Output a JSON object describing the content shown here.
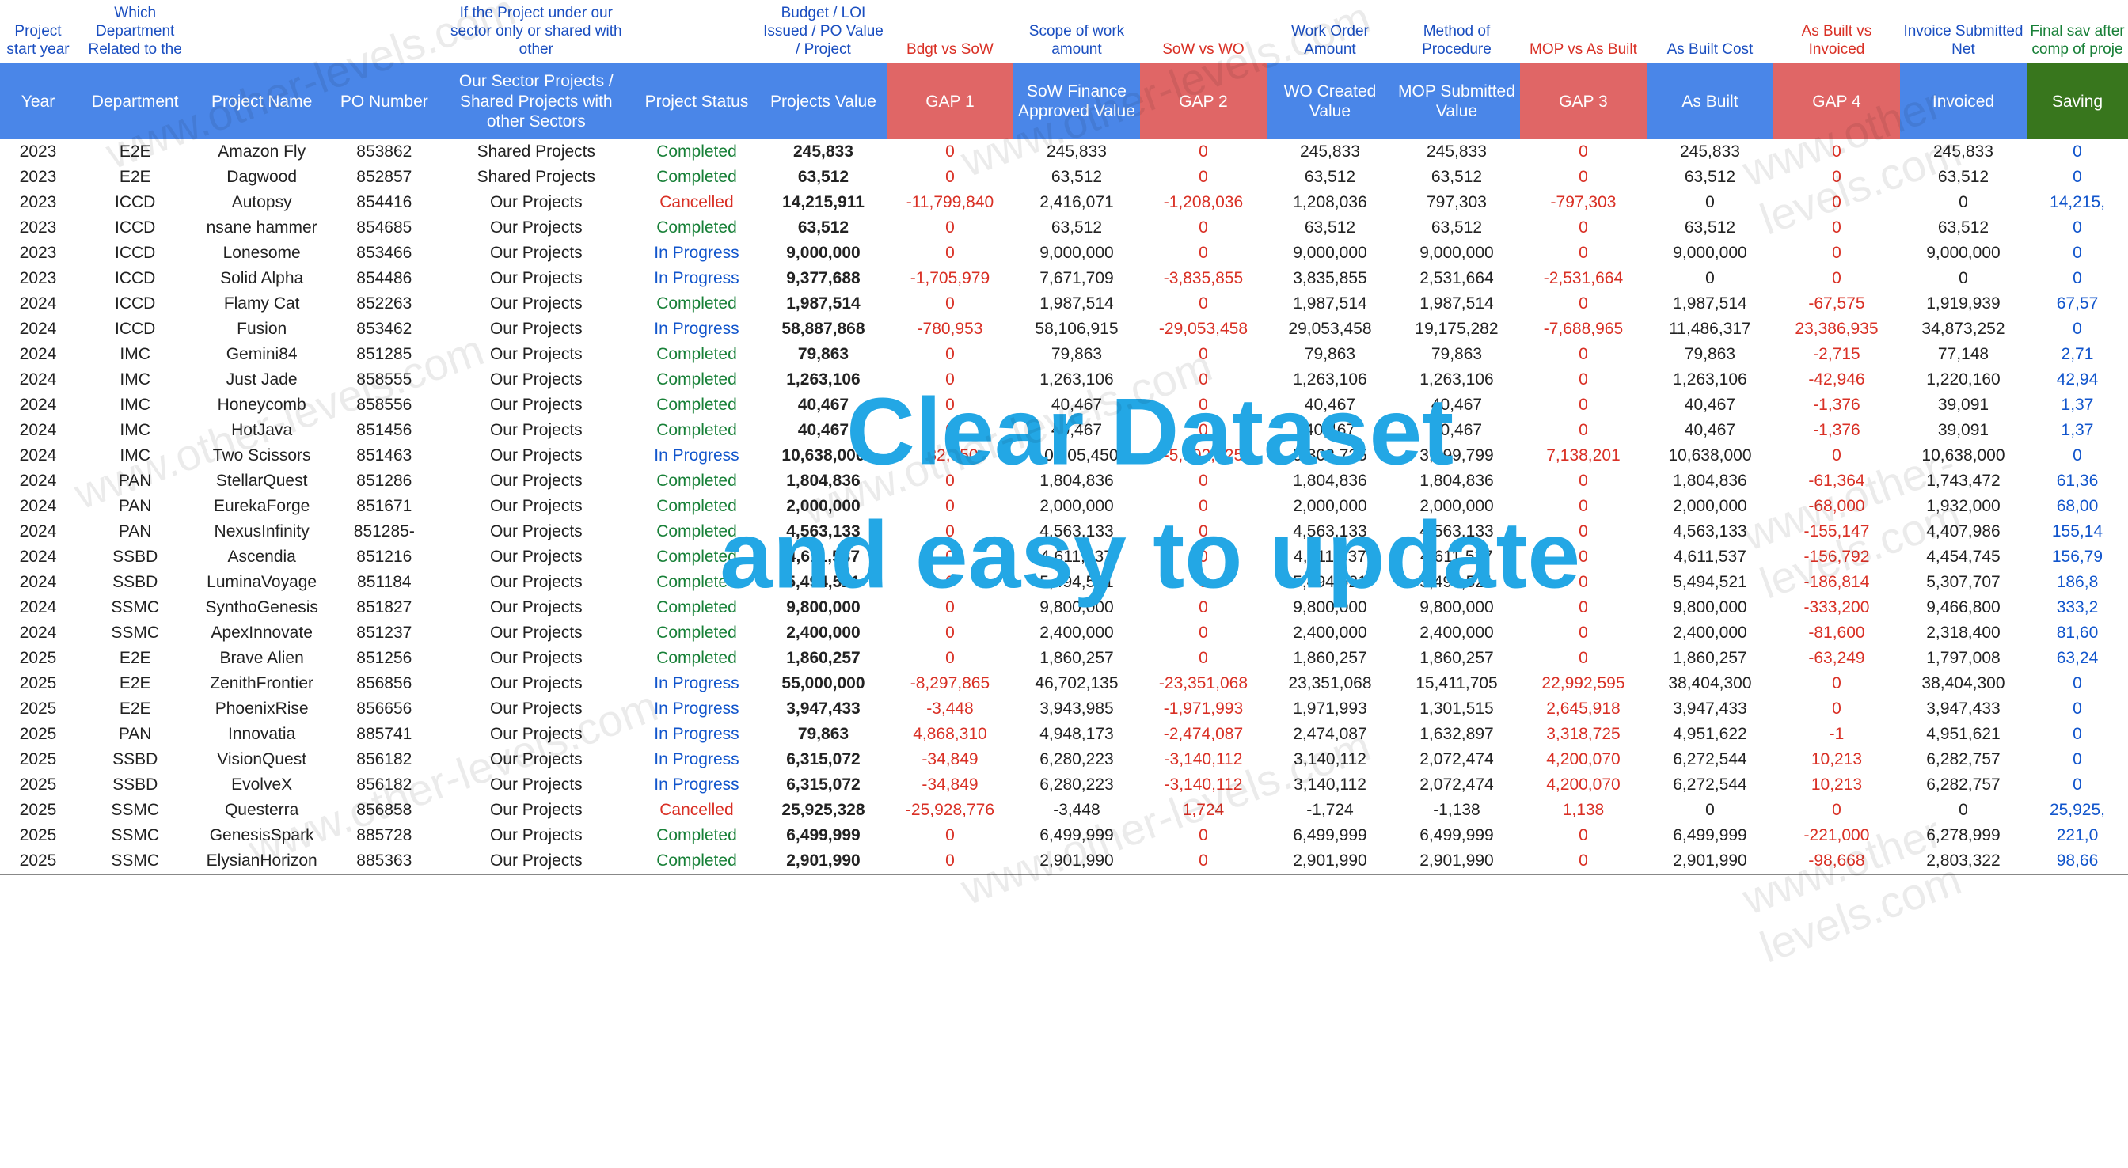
{
  "overlay": {
    "line1": "Clear Dataset",
    "line2": "and easy to update"
  },
  "watermark": "www.other-levels.com",
  "columns_desc": [
    {
      "text": "Project start year",
      "cls": ""
    },
    {
      "text": "Which Department Related to the",
      "cls": ""
    },
    {
      "text": "",
      "cls": ""
    },
    {
      "text": "",
      "cls": ""
    },
    {
      "text": "If the Project under our sector only or shared with other",
      "cls": ""
    },
    {
      "text": "",
      "cls": ""
    },
    {
      "text": "Budget / LOI Issued / PO Value / Project",
      "cls": ""
    },
    {
      "text": "Bdgt vs SoW",
      "cls": "red"
    },
    {
      "text": "Scope of work amount",
      "cls": ""
    },
    {
      "text": "SoW vs WO",
      "cls": "red"
    },
    {
      "text": "Work Order Amount",
      "cls": ""
    },
    {
      "text": "Method of Procedure",
      "cls": ""
    },
    {
      "text": "MOP vs As Built",
      "cls": "red"
    },
    {
      "text": "As Built Cost",
      "cls": ""
    },
    {
      "text": "As Built vs Invoiced",
      "cls": "red"
    },
    {
      "text": "Invoice Submitted Net",
      "cls": ""
    },
    {
      "text": "Final sav after comp of proje",
      "cls": "green"
    }
  ],
  "columns_main": [
    {
      "text": "Year",
      "cls": "blue"
    },
    {
      "text": "Department",
      "cls": "blue"
    },
    {
      "text": "Project Name",
      "cls": "blue"
    },
    {
      "text": "PO Number",
      "cls": "blue"
    },
    {
      "text": "Our Sector Projects / Shared Projects with other Sectors",
      "cls": "blue"
    },
    {
      "text": "Project Status",
      "cls": "blue"
    },
    {
      "text": "Projects Value",
      "cls": "blue"
    },
    {
      "text": "GAP 1",
      "cls": "redbg"
    },
    {
      "text": "SoW Finance Approved Value",
      "cls": "blue"
    },
    {
      "text": "GAP 2",
      "cls": "redbg"
    },
    {
      "text": "WO Created Value",
      "cls": "blue"
    },
    {
      "text": "MOP Submitted Value",
      "cls": "blue"
    },
    {
      "text": "GAP 3",
      "cls": "redbg"
    },
    {
      "text": "As Built",
      "cls": "blue"
    },
    {
      "text": "GAP 4",
      "cls": "redbg"
    },
    {
      "text": "Invoiced",
      "cls": "blue"
    },
    {
      "text": "Saving",
      "cls": "greenbg"
    }
  ],
  "rows": [
    {
      "year": "2023",
      "dept": "E2E",
      "proj": "Amazon Fly",
      "po": "853862",
      "sector": "Shared Projects",
      "status": "Completed",
      "pv": "245,833",
      "g1": "0",
      "sow": "245,833",
      "g2": "0",
      "wo": "245,833",
      "mop": "245,833",
      "g3": "0",
      "asb": "245,833",
      "g4": "0",
      "inv": "245,833",
      "sav": "0"
    },
    {
      "year": "2023",
      "dept": "E2E",
      "proj": "Dagwood",
      "po": "852857",
      "sector": "Shared Projects",
      "status": "Completed",
      "pv": "63,512",
      "g1": "0",
      "sow": "63,512",
      "g2": "0",
      "wo": "63,512",
      "mop": "63,512",
      "g3": "0",
      "asb": "63,512",
      "g4": "0",
      "inv": "63,512",
      "sav": "0"
    },
    {
      "year": "2023",
      "dept": "ICCD",
      "proj": "Autopsy",
      "po": "854416",
      "sector": "Our Projects",
      "status": "Cancelled",
      "pv": "14,215,911",
      "g1": "-11,799,840",
      "sow": "2,416,071",
      "g2": "-1,208,036",
      "wo": "1,208,036",
      "mop": "797,303",
      "g3": "-797,303",
      "asb": "0",
      "g4": "0",
      "inv": "0",
      "sav": "14,215,"
    },
    {
      "year": "2023",
      "dept": "ICCD",
      "proj": "nsane hammer",
      "po": "854685",
      "sector": "Our Projects",
      "status": "Completed",
      "pv": "63,512",
      "g1": "0",
      "sow": "63,512",
      "g2": "0",
      "wo": "63,512",
      "mop": "63,512",
      "g3": "0",
      "asb": "63,512",
      "g4": "0",
      "inv": "63,512",
      "sav": "0"
    },
    {
      "year": "2023",
      "dept": "ICCD",
      "proj": "Lonesome",
      "po": "853466",
      "sector": "Our Projects",
      "status": "In Progress",
      "pv": "9,000,000",
      "g1": "0",
      "sow": "9,000,000",
      "g2": "0",
      "wo": "9,000,000",
      "mop": "9,000,000",
      "g3": "0",
      "asb": "9,000,000",
      "g4": "0",
      "inv": "9,000,000",
      "sav": "0"
    },
    {
      "year": "2023",
      "dept": "ICCD",
      "proj": "Solid Alpha",
      "po": "854486",
      "sector": "Our Projects",
      "status": "In Progress",
      "pv": "9,377,688",
      "g1": "-1,705,979",
      "sow": "7,671,709",
      "g2": "-3,835,855",
      "wo": "3,835,855",
      "mop": "2,531,664",
      "g3": "-2,531,664",
      "asb": "0",
      "g4": "0",
      "inv": "0",
      "sav": "0"
    },
    {
      "year": "2024",
      "dept": "ICCD",
      "proj": "Flamy Cat",
      "po": "852263",
      "sector": "Our Projects",
      "status": "Completed",
      "pv": "1,987,514",
      "g1": "0",
      "sow": "1,987,514",
      "g2": "0",
      "wo": "1,987,514",
      "mop": "1,987,514",
      "g3": "0",
      "asb": "1,987,514",
      "g4": "-67,575",
      "inv": "1,919,939",
      "sav": "67,57"
    },
    {
      "year": "2024",
      "dept": "ICCD",
      "proj": "Fusion",
      "po": "853462",
      "sector": "Our Projects",
      "status": "In Progress",
      "pv": "58,887,868",
      "g1": "-780,953",
      "sow": "58,106,915",
      "g2": "-29,053,458",
      "wo": "29,053,458",
      "mop": "19,175,282",
      "g3": "-7,688,965",
      "asb": "11,486,317",
      "g4": "23,386,935",
      "inv": "34,873,252",
      "sav": "0"
    },
    {
      "year": "2024",
      "dept": "IMC",
      "proj": "Gemini84",
      "po": "851285",
      "sector": "Our Projects",
      "status": "Completed",
      "pv": "79,863",
      "g1": "0",
      "sow": "79,863",
      "g2": "0",
      "wo": "79,863",
      "mop": "79,863",
      "g3": "0",
      "asb": "79,863",
      "g4": "-2,715",
      "inv": "77,148",
      "sav": "2,71"
    },
    {
      "year": "2024",
      "dept": "IMC",
      "proj": "Just Jade",
      "po": "858555",
      "sector": "Our Projects",
      "status": "Completed",
      "pv": "1,263,106",
      "g1": "0",
      "sow": "1,263,106",
      "g2": "0",
      "wo": "1,263,106",
      "mop": "1,263,106",
      "g3": "0",
      "asb": "1,263,106",
      "g4": "-42,946",
      "inv": "1,220,160",
      "sav": "42,94"
    },
    {
      "year": "2024",
      "dept": "IMC",
      "proj": "Honeycomb",
      "po": "858556",
      "sector": "Our Projects",
      "status": "Completed",
      "pv": "40,467",
      "g1": "0",
      "sow": "40,467",
      "g2": "0",
      "wo": "40,467",
      "mop": "40,467",
      "g3": "0",
      "asb": "40,467",
      "g4": "-1,376",
      "inv": "39,091",
      "sav": "1,37"
    },
    {
      "year": "2024",
      "dept": "IMC",
      "proj": "HotJava",
      "po": "851456",
      "sector": "Our Projects",
      "status": "Completed",
      "pv": "40,467",
      "g1": "0",
      "sow": "40,467",
      "g2": "0",
      "wo": "40,467",
      "mop": "40,467",
      "g3": "0",
      "asb": "40,467",
      "g4": "-1,376",
      "inv": "39,091",
      "sav": "1,37"
    },
    {
      "year": "2024",
      "dept": "IMC",
      "proj": "Two Scissors",
      "po": "851463",
      "sector": "Our Projects",
      "status": "In Progress",
      "pv": "10,638,000",
      "g1": "-32,550",
      "sow": "10,605,450",
      "g2": "-5,302,725",
      "wo": "5,302,725",
      "mop": "3,499,799",
      "g3": "7,138,201",
      "asb": "10,638,000",
      "g4": "0",
      "inv": "10,638,000",
      "sav": "0"
    },
    {
      "year": "2024",
      "dept": "PAN",
      "proj": "StellarQuest",
      "po": "851286",
      "sector": "Our Projects",
      "status": "Completed",
      "pv": "1,804,836",
      "g1": "0",
      "sow": "1,804,836",
      "g2": "0",
      "wo": "1,804,836",
      "mop": "1,804,836",
      "g3": "0",
      "asb": "1,804,836",
      "g4": "-61,364",
      "inv": "1,743,472",
      "sav": "61,36"
    },
    {
      "year": "2024",
      "dept": "PAN",
      "proj": "EurekaForge",
      "po": "851671",
      "sector": "Our Projects",
      "status": "Completed",
      "pv": "2,000,000",
      "g1": "0",
      "sow": "2,000,000",
      "g2": "0",
      "wo": "2,000,000",
      "mop": "2,000,000",
      "g3": "0",
      "asb": "2,000,000",
      "g4": "-68,000",
      "inv": "1,932,000",
      "sav": "68,00"
    },
    {
      "year": "2024",
      "dept": "PAN",
      "proj": "NexusInfinity",
      "po": "851285-",
      "sector": "Our Projects",
      "status": "Completed",
      "pv": "4,563,133",
      "g1": "0",
      "sow": "4,563,133",
      "g2": "0",
      "wo": "4,563,133",
      "mop": "4,563,133",
      "g3": "0",
      "asb": "4,563,133",
      "g4": "-155,147",
      "inv": "4,407,986",
      "sav": "155,14"
    },
    {
      "year": "2024",
      "dept": "SSBD",
      "proj": "Ascendia",
      "po": "851216",
      "sector": "Our Projects",
      "status": "Completed",
      "pv": "4,611,537",
      "g1": "0",
      "sow": "4,611,537",
      "g2": "0",
      "wo": "4,611,537",
      "mop": "4,611,537",
      "g3": "0",
      "asb": "4,611,537",
      "g4": "-156,792",
      "inv": "4,454,745",
      "sav": "156,79"
    },
    {
      "year": "2024",
      "dept": "SSBD",
      "proj": "LuminaVoyage",
      "po": "851184",
      "sector": "Our Projects",
      "status": "Completed",
      "pv": "5,494,521",
      "g1": "0",
      "sow": "5,494,521",
      "g2": "0",
      "wo": "5,494,521",
      "mop": "5,494,521",
      "g3": "0",
      "asb": "5,494,521",
      "g4": "-186,814",
      "inv": "5,307,707",
      "sav": "186,8"
    },
    {
      "year": "2024",
      "dept": "SSMC",
      "proj": "SynthoGenesis",
      "po": "851827",
      "sector": "Our Projects",
      "status": "Completed",
      "pv": "9,800,000",
      "g1": "0",
      "sow": "9,800,000",
      "g2": "0",
      "wo": "9,800,000",
      "mop": "9,800,000",
      "g3": "0",
      "asb": "9,800,000",
      "g4": "-333,200",
      "inv": "9,466,800",
      "sav": "333,2"
    },
    {
      "year": "2024",
      "dept": "SSMC",
      "proj": "ApexInnovate",
      "po": "851237",
      "sector": "Our Projects",
      "status": "Completed",
      "pv": "2,400,000",
      "g1": "0",
      "sow": "2,400,000",
      "g2": "0",
      "wo": "2,400,000",
      "mop": "2,400,000",
      "g3": "0",
      "asb": "2,400,000",
      "g4": "-81,600",
      "inv": "2,318,400",
      "sav": "81,60"
    },
    {
      "year": "2025",
      "dept": "E2E",
      "proj": "Brave Alien",
      "po": "851256",
      "sector": "Our Projects",
      "status": "Completed",
      "pv": "1,860,257",
      "g1": "0",
      "sow": "1,860,257",
      "g2": "0",
      "wo": "1,860,257",
      "mop": "1,860,257",
      "g3": "0",
      "asb": "1,860,257",
      "g4": "-63,249",
      "inv": "1,797,008",
      "sav": "63,24"
    },
    {
      "year": "2025",
      "dept": "E2E",
      "proj": "ZenithFrontier",
      "po": "856856",
      "sector": "Our Projects",
      "status": "In Progress",
      "pv": "55,000,000",
      "g1": "-8,297,865",
      "sow": "46,702,135",
      "g2": "-23,351,068",
      "wo": "23,351,068",
      "mop": "15,411,705",
      "g3": "22,992,595",
      "asb": "38,404,300",
      "g4": "0",
      "inv": "38,404,300",
      "sav": "0"
    },
    {
      "year": "2025",
      "dept": "E2E",
      "proj": "PhoenixRise",
      "po": "856656",
      "sector": "Our Projects",
      "status": "In Progress",
      "pv": "3,947,433",
      "g1": "-3,448",
      "sow": "3,943,985",
      "g2": "-1,971,993",
      "wo": "1,971,993",
      "mop": "1,301,515",
      "g3": "2,645,918",
      "asb": "3,947,433",
      "g4": "0",
      "inv": "3,947,433",
      "sav": "0"
    },
    {
      "year": "2025",
      "dept": "PAN",
      "proj": "Innovatia",
      "po": "885741",
      "sector": "Our Projects",
      "status": "In Progress",
      "pv": "79,863",
      "g1": "4,868,310",
      "sow": "4,948,173",
      "g2": "-2,474,087",
      "wo": "2,474,087",
      "mop": "1,632,897",
      "g3": "3,318,725",
      "asb": "4,951,622",
      "g4": "-1",
      "inv": "4,951,621",
      "sav": "0"
    },
    {
      "year": "2025",
      "dept": "SSBD",
      "proj": "VisionQuest",
      "po": "856182",
      "sector": "Our Projects",
      "status": "In Progress",
      "pv": "6,315,072",
      "g1": "-34,849",
      "sow": "6,280,223",
      "g2": "-3,140,112",
      "wo": "3,140,112",
      "mop": "2,072,474",
      "g3": "4,200,070",
      "asb": "6,272,544",
      "g4": "10,213",
      "inv": "6,282,757",
      "sav": "0"
    },
    {
      "year": "2025",
      "dept": "SSBD",
      "proj": "EvolveX",
      "po": "856182",
      "sector": "Our Projects",
      "status": "In Progress",
      "pv": "6,315,072",
      "g1": "-34,849",
      "sow": "6,280,223",
      "g2": "-3,140,112",
      "wo": "3,140,112",
      "mop": "2,072,474",
      "g3": "4,200,070",
      "asb": "6,272,544",
      "g4": "10,213",
      "inv": "6,282,757",
      "sav": "0"
    },
    {
      "year": "2025",
      "dept": "SSMC",
      "proj": "Questerra",
      "po": "856858",
      "sector": "Our Projects",
      "status": "Cancelled",
      "pv": "25,925,328",
      "g1": "-25,928,776",
      "sow": "-3,448",
      "g2": "1,724",
      "wo": "-1,724",
      "mop": "-1,138",
      "g3": "1,138",
      "asb": "0",
      "g4": "0",
      "inv": "0",
      "sav": "25,925,"
    },
    {
      "year": "2025",
      "dept": "SSMC",
      "proj": "GenesisSpark",
      "po": "885728",
      "sector": "Our Projects",
      "status": "Completed",
      "pv": "6,499,999",
      "g1": "0",
      "sow": "6,499,999",
      "g2": "0",
      "wo": "6,499,999",
      "mop": "6,499,999",
      "g3": "0",
      "asb": "6,499,999",
      "g4": "-221,000",
      "inv": "6,278,999",
      "sav": "221,0"
    },
    {
      "year": "2025",
      "dept": "SSMC",
      "proj": "ElysianHorizon",
      "po": "885363",
      "sector": "Our Projects",
      "status": "Completed",
      "pv": "2,901,990",
      "g1": "0",
      "sow": "2,901,990",
      "g2": "0",
      "wo": "2,901,990",
      "mop": "2,901,990",
      "g3": "0",
      "asb": "2,901,990",
      "g4": "-98,668",
      "inv": "2,803,322",
      "sav": "98,66"
    }
  ],
  "status_colors": {
    "Completed": "green",
    "Cancelled": "red",
    "In Progress": "blue"
  }
}
